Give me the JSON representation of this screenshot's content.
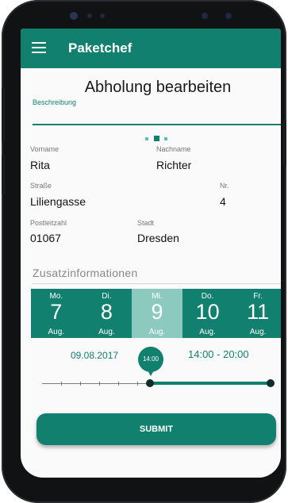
{
  "app": {
    "title": "Paketchef",
    "menu_icon": "hamburger-menu-icon"
  },
  "page": {
    "title": "Abholung bearbeiten"
  },
  "description": {
    "label": "Beschreibung",
    "value": ""
  },
  "pager": {
    "count": 3,
    "active_index": 1
  },
  "fields": {
    "vorname": {
      "label": "Vorname",
      "value": "Rita"
    },
    "nachname": {
      "label": "Nachname",
      "value": "Richter"
    },
    "strasse": {
      "label": "Straße",
      "value": "Liliengasse"
    },
    "nr": {
      "label": "Nr.",
      "value": "4"
    },
    "plz": {
      "label": "Postleitzahl",
      "value": "01067"
    },
    "stadt": {
      "label": "Stadt",
      "value": "Dresden"
    }
  },
  "zusatz": {
    "label": "Zusatzinformationen"
  },
  "days": [
    {
      "name": "Mo.",
      "num": "7",
      "month": "Aug.",
      "selected": false
    },
    {
      "name": "Di.",
      "num": "8",
      "month": "Aug.",
      "selected": false
    },
    {
      "name": "Mi.",
      "num": "9",
      "month": "Aug.",
      "selected": true
    },
    {
      "name": "Do.",
      "num": "10",
      "month": "Aug.",
      "selected": false
    },
    {
      "name": "Fr.",
      "num": "11",
      "month": "Aug.",
      "selected": false
    }
  ],
  "selection": {
    "date": "09.08.2017",
    "time_range": "14:00 - 20:00",
    "slider_bubble": "14:00"
  },
  "submit_label": "SUBMIT",
  "colors": {
    "primary": "#12806f",
    "selected_day": "#8ccac0",
    "background": "#fafafa"
  }
}
